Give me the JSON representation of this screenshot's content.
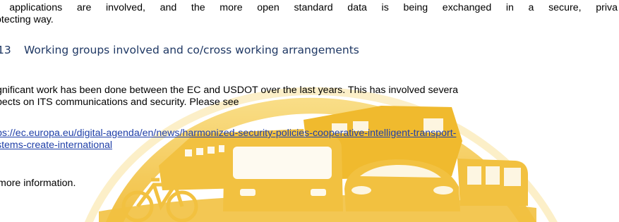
{
  "intro": {
    "line1": "re applications are involved, and the more open standard data is being exchanged in a secure, priva",
    "line2": "otecting way."
  },
  "section": {
    "number": "13",
    "title": "Working groups involved and co/cross working arrangements"
  },
  "paragraph": {
    "line1": "gnificant work has been done between the EC and USDOT over the last years. This has involved severa",
    "line2": "pects on ITS communications and security. Please see"
  },
  "link": {
    "line1": "ps://ec.europa.eu/digital-agenda/en/news/harmonized-security-policies-cooperative-intelligent-transport-",
    "line2": "stems-create-international"
  },
  "closing": {
    "text": "more information."
  },
  "colors": {
    "heading": "#1F3864",
    "link": "#1f3fa8",
    "watermark": "#F5C84A"
  }
}
